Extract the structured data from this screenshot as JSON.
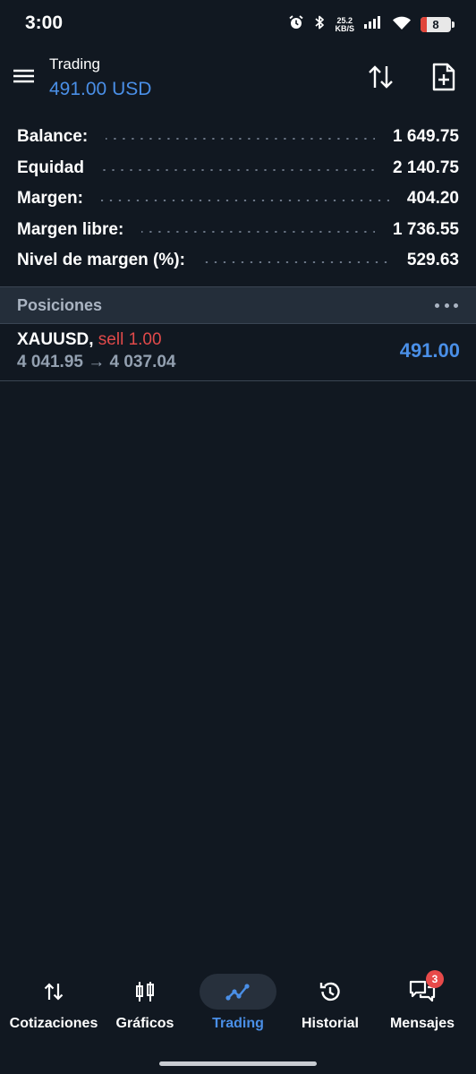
{
  "status_bar": {
    "time": "3:00",
    "net_speed_value": "25.2",
    "net_speed_unit": "KB/S",
    "battery_level": "8",
    "icons": [
      "alarm-icon",
      "bluetooth-icon",
      "signal-icon",
      "wifi-icon",
      "battery-icon"
    ]
  },
  "header": {
    "title": "Trading",
    "subtitle": "491.00 USD",
    "icons": [
      "menu-icon",
      "sort-icon",
      "new-order-icon"
    ]
  },
  "summary": [
    {
      "label": "Balance:",
      "value": "1 649.75"
    },
    {
      "label": "Equidad",
      "value": "2 140.75"
    },
    {
      "label": "Margen:",
      "value": "404.20"
    },
    {
      "label": "Margen libre:",
      "value": "1 736.55"
    },
    {
      "label": "Nivel de margen (%):",
      "value": "529.63"
    }
  ],
  "positions": {
    "title": "Posiciones",
    "items": [
      {
        "symbol": "XAUUSD,",
        "side": "sell 1.00",
        "prices": "4 041.95 → 4 037.04",
        "profit": "491.00"
      }
    ]
  },
  "nav": {
    "items": [
      {
        "label": "Cotizaciones",
        "icon": "quotes-icon"
      },
      {
        "label": "Gráficos",
        "icon": "charts-icon"
      },
      {
        "label": "Trading",
        "icon": "trading-icon",
        "active": true
      },
      {
        "label": "Historial",
        "icon": "history-icon"
      },
      {
        "label": "Mensajes",
        "icon": "messages-icon",
        "badge": "3"
      }
    ]
  },
  "colors": {
    "background": "#111821",
    "accent": "#4a8fe7",
    "sell": "#e14a4a",
    "muted": "#93a0b0",
    "section_bg": "#242e3a"
  }
}
